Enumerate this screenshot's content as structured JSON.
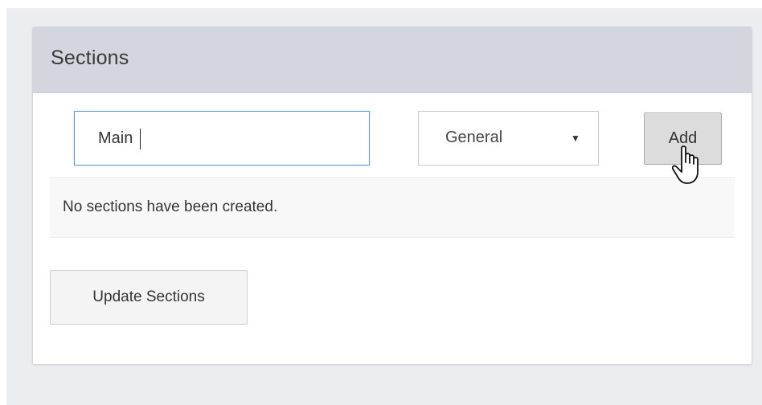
{
  "panel": {
    "title": "Sections"
  },
  "form": {
    "section_name_value": "Main",
    "section_type_selected": "General",
    "select_arrow_glyph": "▼",
    "add_label": "Add"
  },
  "sections_list": {
    "empty_message": "No sections have been created."
  },
  "actions": {
    "update_label": "Update Sections"
  },
  "colors": {
    "header_bg": "#d3d6de",
    "page_bg": "#ecedf1",
    "input_focus_border": "#5b9bd0",
    "empty_row_bg": "#f8f8f8"
  },
  "icons": {
    "cursor": "hand-pointer-icon",
    "dropdown": "caret-down-icon"
  }
}
